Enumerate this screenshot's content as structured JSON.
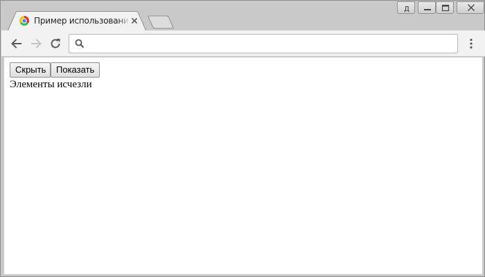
{
  "window": {
    "tab_title": "Пример использования jQuery",
    "controls": {
      "profile_label": "Д"
    }
  },
  "toolbar": {
    "address_value": "",
    "address_placeholder": ""
  },
  "page": {
    "hide_button_label": "Скрыть",
    "show_button_label": "Показать",
    "status_text": "Элементы исчезли"
  },
  "colors": {
    "chrome_frame": "#c9c9c9",
    "toolbar_bg": "#f2f2f2",
    "active_tab": "#f2f2f2"
  },
  "icons": {
    "favicon": "chrome-loading-icon",
    "back": "arrow-left-icon",
    "forward": "arrow-right-icon",
    "reload": "reload-icon",
    "search": "search-icon",
    "menu": "more-vert-icon",
    "close_tab": "close-icon"
  }
}
